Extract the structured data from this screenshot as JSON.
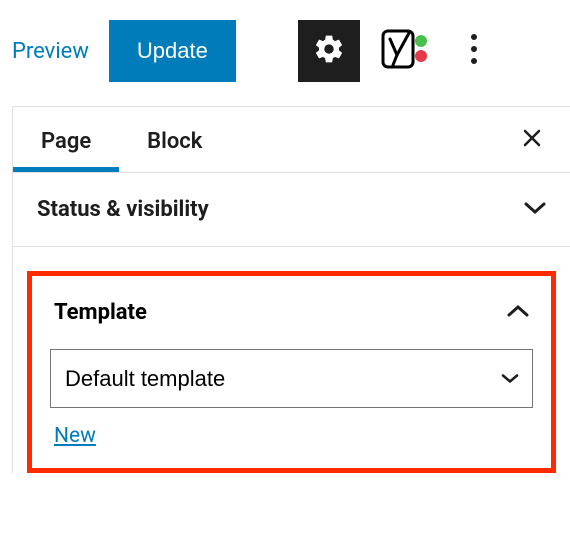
{
  "toolbar": {
    "preview_label": "Preview",
    "update_label": "Update"
  },
  "tabs": {
    "items": [
      {
        "label": "Page",
        "active": true
      },
      {
        "label": "Block",
        "active": false
      }
    ]
  },
  "sections": {
    "status": {
      "title": "Status & visibility"
    },
    "template": {
      "title": "Template",
      "selected": "Default template",
      "new_label": "New"
    }
  }
}
